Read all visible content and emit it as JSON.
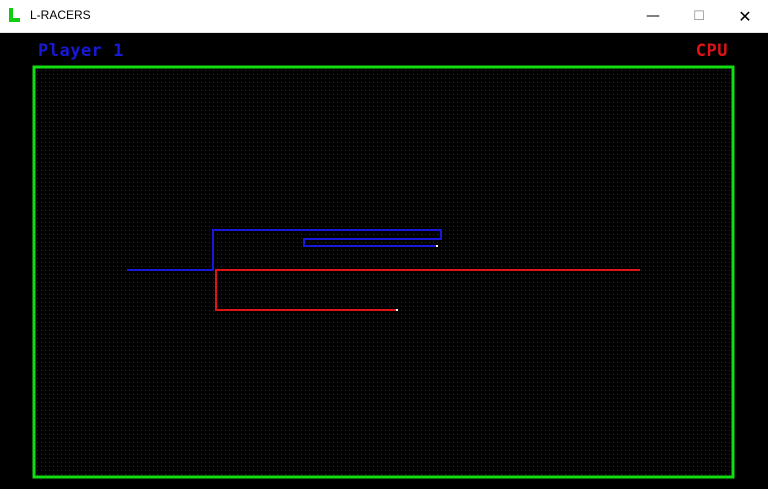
{
  "window": {
    "title": "L-RACERS",
    "icon": "l-letter-icon",
    "controls": [
      "minimize-icon",
      "maximize-icon",
      "close-icon"
    ],
    "min_glyph": "—",
    "max_glyph": "☐",
    "close_glyph": "✕"
  },
  "hud": {
    "player_label": "Player 1",
    "cpu_label": "CPU"
  },
  "colors": {
    "frame": "#11dd11",
    "player": "#1818d8",
    "cpu": "#e01414",
    "head": "#ffffff",
    "grid_dot": "#2a2a2a",
    "background": "#000000"
  }
}
